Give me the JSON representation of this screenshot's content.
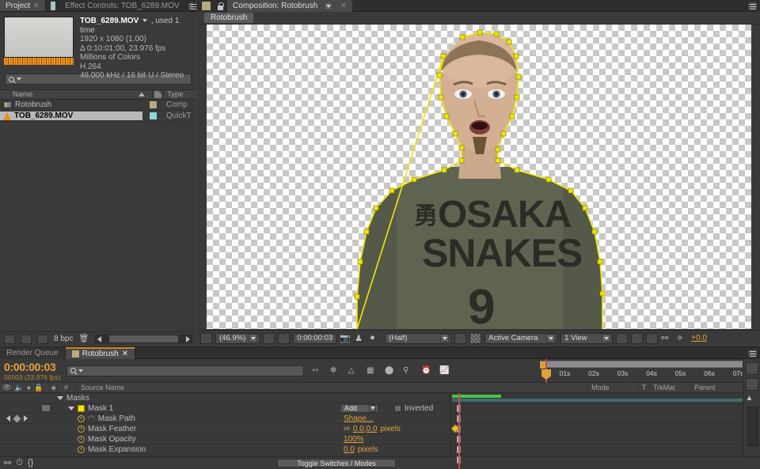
{
  "project": {
    "tabs": [
      {
        "label": "Project",
        "active": true,
        "closable": true
      },
      {
        "label": "Effect Controls: TOB_6289.MOV",
        "active": false,
        "closable": false
      }
    ],
    "asset": {
      "title": "TOB_6289.MOV",
      "used": ", used 1 time",
      "dimensions": "1920 x 1080 (1.00)",
      "duration": "Δ 0:10:01:00, 23.976 fps",
      "colors": "Millions of Colors",
      "codec": "H.264",
      "audio": "48.000 kHz / 16 bit U / Stereo"
    },
    "search_placeholder": "",
    "columns": {
      "name": "Name",
      "type": "Type"
    },
    "items": [
      {
        "name": "Rotobrush",
        "type": "Comp",
        "icon": "composition-icon",
        "selected": false
      },
      {
        "name": "TOB_6289.MOV",
        "type": "QuickT",
        "icon": "movie-icon",
        "selected": true
      }
    ],
    "footer": {
      "bit_depth": "8 bpc"
    }
  },
  "composition": {
    "tabs": [
      {
        "label": "Composition: Rotobrush",
        "active": true,
        "closable": true
      }
    ],
    "breadcrumb": "Rotobrush",
    "toolbar": {
      "zoom": "(46.9%)",
      "timecode": "0:00:00:03",
      "resolution": "(Half)",
      "camera": "Active Camera",
      "views": "1 View",
      "exposure": "+0.0"
    },
    "shirt": {
      "kanji": "勇",
      "line1": "OSAKA",
      "line2": "SNAKES",
      "number": "9"
    }
  },
  "timeline": {
    "tabs": [
      {
        "label": "Render Queue",
        "active": false,
        "closable": false
      },
      {
        "label": "Rotobrush",
        "active": true,
        "closable": true
      }
    ],
    "timecode": "0:00:00:03",
    "frame_info": "00003 (23.976 fps)",
    "search_placeholder": "",
    "columns": {
      "hash": "#",
      "source_name": "Source Name",
      "mode": "Mode",
      "t": "T",
      "trkmat": "TrkMat",
      "parent": "Parent"
    },
    "ruler_ticks": [
      "01s",
      "02s",
      "03s",
      "04s",
      "05s",
      "06s",
      "07s"
    ],
    "rows": [
      {
        "name": "Masks",
        "kind": "group",
        "indent": 1
      },
      {
        "name": "Mask 1",
        "kind": "mask",
        "indent": 2,
        "mode": "Add",
        "inverted_label": "Inverted",
        "swatch": "#f2e600"
      },
      {
        "name": "Mask Path",
        "kind": "prop",
        "indent": 3,
        "value": "Shape...",
        "keyframed": true
      },
      {
        "name": "Mask Feather",
        "kind": "prop",
        "indent": 3,
        "value": "0.0,0.0",
        "unit": "pixels",
        "linked": true
      },
      {
        "name": "Mask Opacity",
        "kind": "prop",
        "indent": 3,
        "value": "100%",
        "unit": ""
      },
      {
        "name": "Mask Expansion",
        "kind": "prop",
        "indent": 3,
        "value": "0.0",
        "unit": "pixels"
      }
    ],
    "footer": {
      "toggle": "Toggle Switches / Modes"
    }
  },
  "colors": {
    "accent_orange": "#e0a33c",
    "mask_yellow": "#f2e600",
    "playhead_red": "#c0504d",
    "render_green": "#49c24a",
    "panel_bg": "#3a3a3a"
  }
}
